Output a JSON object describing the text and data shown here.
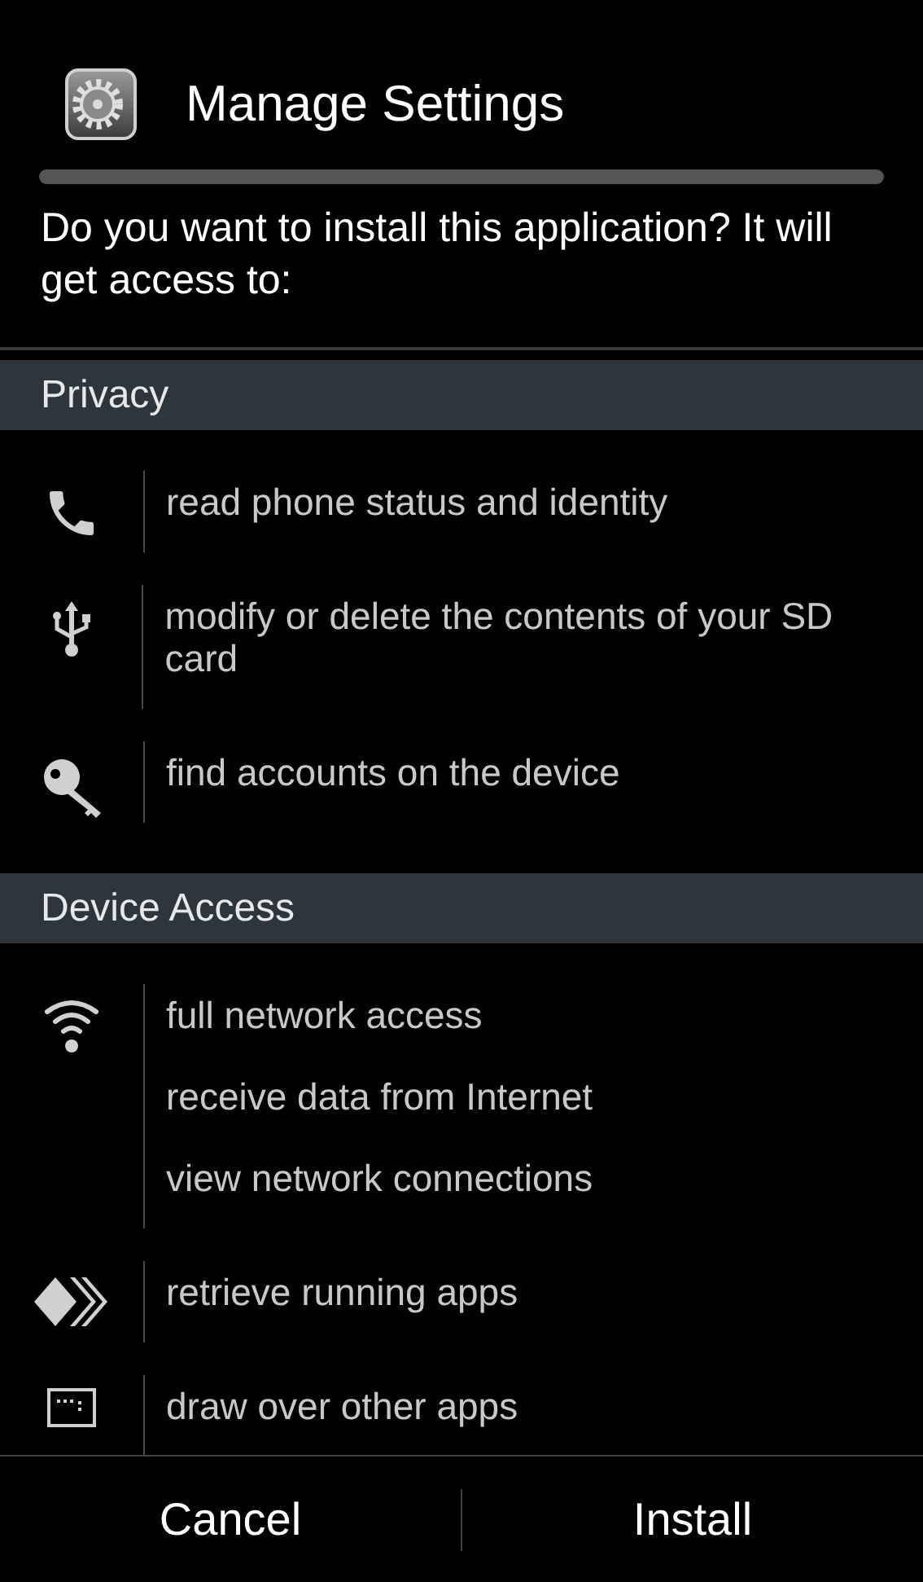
{
  "dialog": {
    "title": "Manage Settings",
    "prompt": "Do you want to install this application? It will get access to:"
  },
  "sections": [
    {
      "title": "Privacy",
      "groups": [
        {
          "kind": "phone",
          "permissions": [
            "read phone status and identity"
          ]
        },
        {
          "kind": "usb",
          "permissions": [
            "modify or delete the contents of your SD card"
          ]
        },
        {
          "kind": "key",
          "permissions": [
            "find accounts on the device"
          ]
        }
      ]
    },
    {
      "title": "Device Access",
      "groups": [
        {
          "kind": "wifi",
          "permissions": [
            "full network access",
            "receive data from Internet",
            "view network connections"
          ]
        },
        {
          "kind": "apps",
          "permissions": [
            "retrieve running apps"
          ]
        },
        {
          "kind": "window",
          "permissions": [
            "draw over other apps"
          ]
        }
      ]
    }
  ],
  "buttons": [
    "Cancel",
    "Install"
  ]
}
